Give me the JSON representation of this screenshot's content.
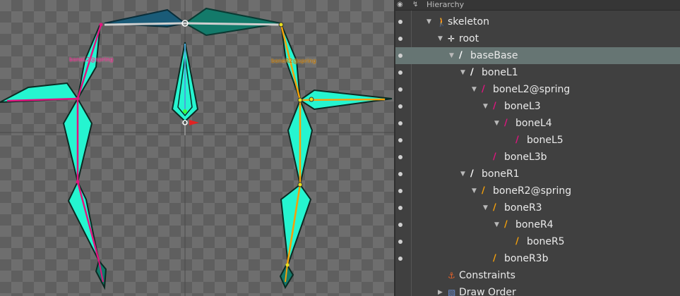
{
  "viewport": {
    "bone_labels": [
      {
        "id": "left",
        "text": "boneL2@spring",
        "color": "#e0157f"
      },
      {
        "id": "right",
        "text": "boneR2@spring",
        "color": "#f5a00a"
      }
    ],
    "colors": {
      "left_bone": "#e0157f",
      "right_bone": "#f5a00a",
      "attachment": "#25f5d0",
      "root_bone_left": "#1a5b78",
      "root_bone_right": "#137a6a"
    }
  },
  "hierarchy": {
    "title": "Hierarchy",
    "header_icons": [
      "eye-icon",
      "bone-chain-icon"
    ],
    "rows": [
      {
        "label": "skeleton",
        "depth": 0,
        "icon": "skeleton-icon",
        "expanded": true,
        "selected": false
      },
      {
        "label": "root",
        "depth": 1,
        "icon": "root-crosshair-icon",
        "expanded": true,
        "selected": false
      },
      {
        "label": "baseBase",
        "depth": 2,
        "icon": "bone-icon",
        "icon_color": "#ffffff",
        "expanded": true,
        "selected": true
      },
      {
        "label": "boneL1",
        "depth": 3,
        "icon": "bone-icon",
        "icon_color": "#ffffff",
        "expanded": true,
        "selected": false
      },
      {
        "label": "boneL2@spring",
        "depth": 4,
        "icon": "bone-icon",
        "icon_color": "#e0157f",
        "expanded": true,
        "selected": false
      },
      {
        "label": "boneL3",
        "depth": 5,
        "icon": "bone-icon",
        "icon_color": "#e0157f",
        "expanded": true,
        "selected": false
      },
      {
        "label": "boneL4",
        "depth": 6,
        "icon": "bone-icon",
        "icon_color": "#e0157f",
        "expanded": true,
        "selected": false
      },
      {
        "label": "boneL5",
        "depth": 7,
        "icon": "bone-icon",
        "icon_color": "#e0157f",
        "expanded": null,
        "selected": false
      },
      {
        "label": "boneL3b",
        "depth": 5,
        "icon": "bone-icon",
        "icon_color": "#e0157f",
        "expanded": null,
        "selected": false
      },
      {
        "label": "boneR1",
        "depth": 3,
        "icon": "bone-icon",
        "icon_color": "#ffffff",
        "expanded": true,
        "selected": false
      },
      {
        "label": "boneR2@spring",
        "depth": 4,
        "icon": "bone-icon",
        "icon_color": "#f5a00a",
        "expanded": true,
        "selected": false
      },
      {
        "label": "boneR3",
        "depth": 5,
        "icon": "bone-icon",
        "icon_color": "#f5a00a",
        "expanded": true,
        "selected": false
      },
      {
        "label": "boneR4",
        "depth": 6,
        "icon": "bone-icon",
        "icon_color": "#f5a00a",
        "expanded": true,
        "selected": false
      },
      {
        "label": "boneR5",
        "depth": 7,
        "icon": "bone-icon",
        "icon_color": "#f5a00a",
        "expanded": null,
        "selected": false
      },
      {
        "label": "boneR3b",
        "depth": 5,
        "icon": "bone-icon",
        "icon_color": "#f5a00a",
        "expanded": null,
        "selected": false
      },
      {
        "label": "Constraints",
        "depth": 1,
        "icon": "constraints-icon",
        "expanded": null,
        "selected": false
      },
      {
        "label": "Draw Order",
        "depth": 1,
        "icon": "draw-order-icon",
        "expanded": false,
        "selected": false
      }
    ]
  }
}
